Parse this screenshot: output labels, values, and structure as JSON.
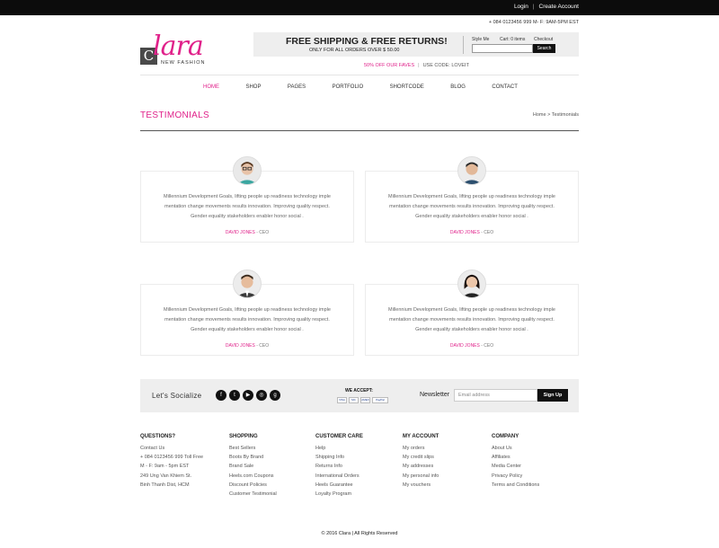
{
  "topbar": {
    "login": "Login",
    "separator": "|",
    "create_account": "Create Account"
  },
  "contact_line": "+ 084 0123456 999    M- F: 9AM-5PM EST",
  "logo": {
    "mark": "C",
    "script": "lara",
    "tagline": "NEW FASHION"
  },
  "promo": {
    "headline": "FREE SHIPPING & FREE RETURNS!",
    "subline": "ONLY FOR ALL ORDERS OVER $ 50.00",
    "style_me": "Style Me",
    "cart": "Cart: 0 items",
    "checkout": "Checkout",
    "search_button": "Search"
  },
  "offer": {
    "discount": "50% OFF OUR FAVES",
    "separator": "|",
    "code": "USE CODE: LOVEIT"
  },
  "nav": [
    "HOME",
    "SHOP",
    "PAGES",
    "PORTFOLIO",
    "SHORTCODE",
    "BLOG",
    "CONTACT"
  ],
  "page": {
    "title": "TESTIMONIALS",
    "breadcrumb": "Home  >  Testimonials"
  },
  "testimonials": [
    {
      "line1": "Millennium Development Goals, lifting people up readiness technology imple",
      "line2": "mentation change movements results innovation. Improving quality respect.",
      "line3": "Gender equality stakeholders enabler honor social .",
      "name": "DAVID JONES",
      "role": " - CEO"
    },
    {
      "line1": "Millennium Development Goals, lifting people up readiness technology imple",
      "line2": "mentation change movements results innovation. Improving quality respect.",
      "line3": "Gender equality stakeholders enabler honor social .",
      "name": "DAVID JONES",
      "role": " - CEO"
    },
    {
      "line1": "Millennium Development Goals, lifting people up readiness technology imple",
      "line2": "mentation change movements results innovation. Improving quality respect.",
      "line3": "Gender equality stakeholders enabler honor social .",
      "name": "DAVID JONES",
      "role": " - CEO"
    },
    {
      "line1": "Millennium Development Goals, lifting people up readiness technology imple",
      "line2": "mentation change movements results innovation. Improving quality respect.",
      "line3": "Gender equality stakeholders enabler honor social .",
      "name": "DAVID JONES",
      "role": " - CEO"
    }
  ],
  "social": {
    "label": "Let's Socialize",
    "icons": [
      "facebook-icon",
      "twitter-icon",
      "youtube-icon",
      "instagram-icon",
      "google-plus-icon"
    ],
    "we_accept": "WE ACCEPT:",
    "payment_cards": [
      "VISA",
      "MC",
      "AMEX",
      "PayPal"
    ],
    "newsletter_label": "Newsletter",
    "email_placeholder": "Email address",
    "signup": "Sign Up"
  },
  "footer": {
    "questions": {
      "title": "QUESTIONS?",
      "items": [
        "Contact Us",
        "+ 084 0123456 999 Toll Free",
        "M - F: 9am - 5pm EST",
        "249 Ung Van Khiem St.",
        "Binh Thanh Dist, HCM"
      ]
    },
    "shopping": {
      "title": "SHOPPING",
      "items": [
        "Best Sellers",
        "Boots By Brand",
        "Brand Sale",
        "Heels.com Coupons",
        "Discount Policies",
        "Customer Testimonial"
      ]
    },
    "customer_care": {
      "title": "CUSTOMER CARE",
      "items": [
        "Help",
        "Shipping Info",
        "Returns Info",
        "International Orders",
        "Heels Guarantee",
        "Loyalty Program"
      ]
    },
    "my_account": {
      "title": "MY ACCOUNT",
      "items": [
        "My orders",
        "My credit slips",
        "My addresses",
        "My personal info",
        "My vouchers"
      ]
    },
    "company": {
      "title": "COMPANY",
      "items": [
        "About Us",
        "Affiliates",
        "Media Center",
        "Privacy Policy",
        "Terms and Conditions"
      ]
    }
  },
  "copyright": "© 2016 Clara  |  All Rights Reserved",
  "colors": {
    "accent": "#e0218a",
    "topbar": "#0c0c0c",
    "panel": "#eeeeee"
  }
}
